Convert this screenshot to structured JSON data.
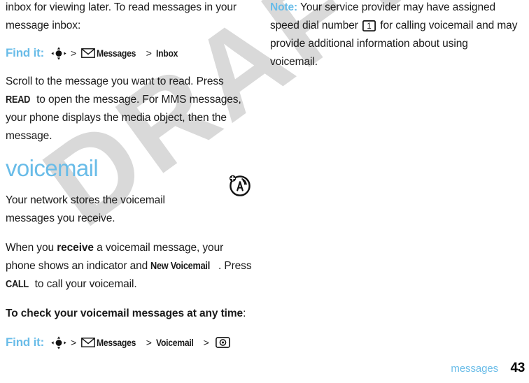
{
  "document": {
    "watermark": "DRAFT",
    "accent_color": "#69bce8",
    "text_color": "#1a1a1a",
    "watermark_color": "#d9d9d9"
  },
  "left_column": {
    "para_intro": {
      "text": "inbox for viewing later. To read messages in your message inbox:"
    },
    "find_it_1": {
      "label": "Find it:",
      "nav_icon": "navigation-key-icon",
      "sep1": ">",
      "messages_icon": "envelope-icon",
      "messages_label": "Messages",
      "sep2": ">",
      "inbox_label": "Inbox"
    },
    "para_scroll": {
      "part1": "Scroll to the message you want to read. Press ",
      "key_read": "READ",
      "part2": " to open the message. For MMS messages, your phone displays the media object, then the message."
    },
    "heading_voicemail": "voicemail",
    "para_network": {
      "text": "Your network stores the voicemail messages you receive."
    },
    "voicemail_indicator_icon": "new-voicemail-indicator-icon",
    "para_receive": {
      "part1": "When you ",
      "bold1": "receive",
      "part2": " a voicemail message, your phone shows an indicator and ",
      "key_new_voicemail": "New Voicemail",
      "part3": ". Press ",
      "key_call": "CALL",
      "part4": " to call your voicemail."
    },
    "para_check": {
      "bold": "To check your voicemail messages at any time",
      "tail": ":"
    },
    "find_it_2": {
      "label": "Find it:",
      "nav_icon": "navigation-key-icon",
      "sep1": ">",
      "messages_icon": "envelope-icon",
      "messages_label": "Messages",
      "sep2": ">",
      "voicemail_label": "Voicemail",
      "sep3": ">",
      "call_icon": "call-key-icon"
    }
  },
  "right_column": {
    "note": {
      "label": "Note:",
      "part1": " Your service provider may have assigned speed dial number ",
      "key_icon": "key-1-icon",
      "part2": " for calling voicemail and may provide additional information about using voicemail."
    }
  },
  "footer": {
    "section_label": "messages",
    "page_number": "43"
  }
}
